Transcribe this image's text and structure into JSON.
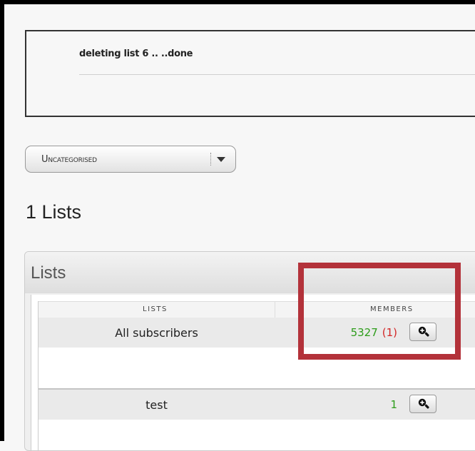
{
  "message": {
    "text": "deleting list 6 .. ..done"
  },
  "category_select": {
    "selected": "Uncategorised"
  },
  "list_count_heading": "1 Lists",
  "lists_panel": {
    "title": "Lists",
    "columns": {
      "lists": "LISTS",
      "members": "MEMBERS"
    },
    "rows": [
      {
        "name": "All subscribers",
        "members": "5327",
        "unconfirmed": "(1)"
      },
      {
        "name": "test",
        "members": "1",
        "unconfirmed": ""
      }
    ]
  },
  "icons": {
    "zoom": "zoom-in-magnifier-icon",
    "dropdown": "chevron-down-icon"
  },
  "colors": {
    "members_count": "#2d9c1a",
    "unconfirmed_count": "#d32626",
    "highlight_box": "#b3323a"
  }
}
